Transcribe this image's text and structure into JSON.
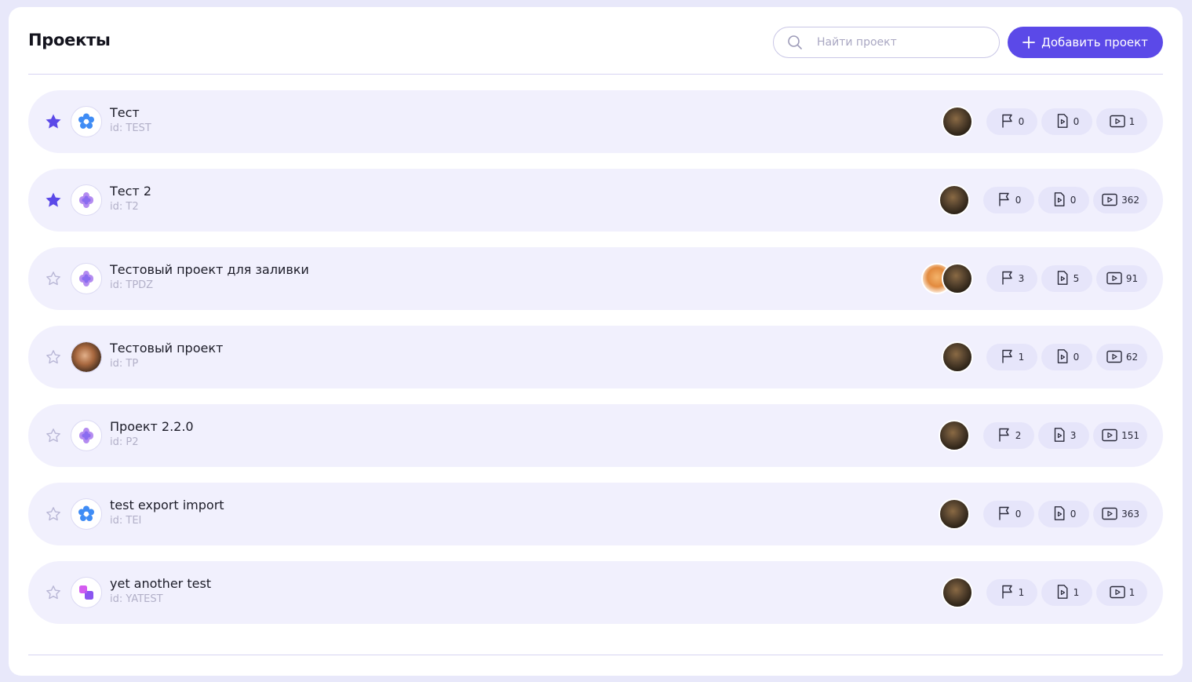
{
  "header": {
    "title": "Проекты",
    "search_placeholder": "Найти проект",
    "add_button_label": "Добавить проект"
  },
  "colors": {
    "accent": "#5b49e8",
    "row_bg": "#f1f0fd",
    "stat_bg": "#e6e5fa"
  },
  "projects": [
    {
      "name": "Тест",
      "id": "id: TEST",
      "favorite": true,
      "logo": "flower-blue-icon",
      "avatars": [
        "cat"
      ],
      "milestones": "0",
      "test_plans": "0",
      "runs": "1"
    },
    {
      "name": "Тест 2",
      "id": "id: T2",
      "favorite": true,
      "logo": "flower-purple-icon",
      "avatars": [
        "cat"
      ],
      "milestones": "0",
      "test_plans": "0",
      "runs": "362"
    },
    {
      "name": "Тестовый проект для заливки",
      "id": "id: TPDZ",
      "favorite": false,
      "logo": "flower-purple-icon",
      "avatars": [
        "fox",
        "cat"
      ],
      "milestones": "3",
      "test_plans": "5",
      "runs": "91"
    },
    {
      "name": "Тестовый проект",
      "id": "id: TP",
      "favorite": false,
      "logo": "photo-logo-icon",
      "avatars": [
        "cat"
      ],
      "milestones": "1",
      "test_plans": "0",
      "runs": "62"
    },
    {
      "name": "Проект 2.2.0",
      "id": "id: P2",
      "favorite": false,
      "logo": "flower-purple-icon",
      "avatars": [
        "cat"
      ],
      "milestones": "2",
      "test_plans": "3",
      "runs": "151"
    },
    {
      "name": "test export import",
      "id": "id: TEI",
      "favorite": false,
      "logo": "flower-blue-icon",
      "avatars": [
        "cat"
      ],
      "milestones": "0",
      "test_plans": "0",
      "runs": "363"
    },
    {
      "name": "yet another test",
      "id": "id: YATEST",
      "favorite": false,
      "logo": "blocks-pink-icon",
      "avatars": [
        "cat"
      ],
      "milestones": "1",
      "test_plans": "1",
      "runs": "1"
    }
  ]
}
